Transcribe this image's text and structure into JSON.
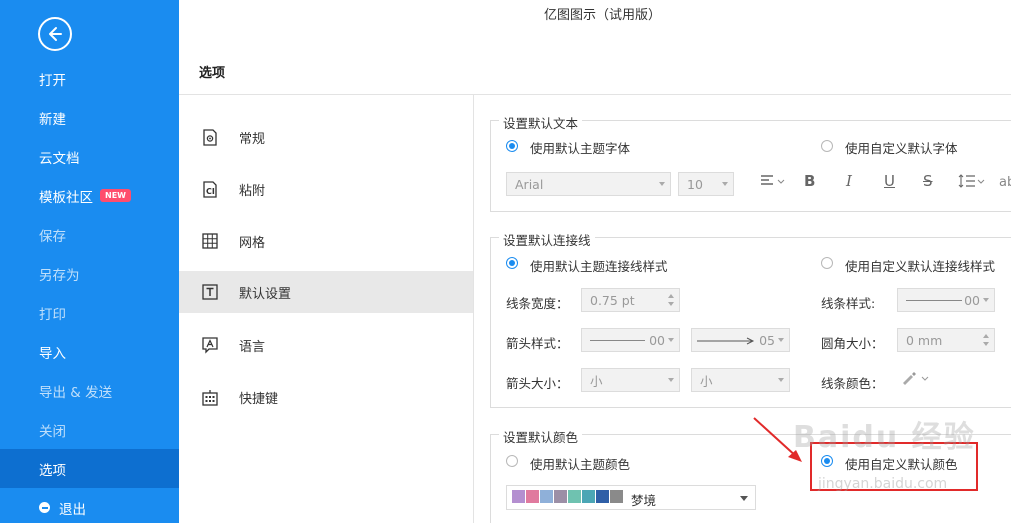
{
  "window": {
    "title": "亿图图示（试用版）"
  },
  "leftnav": {
    "items": [
      {
        "label": "打开",
        "name": "nav-open"
      },
      {
        "label": "新建",
        "name": "nav-new"
      },
      {
        "label": "云文档",
        "name": "nav-cloud-docs"
      },
      {
        "label": "模板社区",
        "name": "nav-template-community"
      },
      {
        "label": "保存",
        "name": "nav-save"
      },
      {
        "label": "另存为",
        "name": "nav-save-as"
      },
      {
        "label": "打印",
        "name": "nav-print"
      },
      {
        "label": "导入",
        "name": "nav-import"
      },
      {
        "label": "导出 & 发送",
        "name": "nav-export-send"
      },
      {
        "label": "关闭",
        "name": "nav-close"
      },
      {
        "label": "选项",
        "name": "nav-options"
      },
      {
        "label": "退出",
        "name": "nav-exit"
      }
    ],
    "badge": "NEW"
  },
  "options": {
    "title": "选项",
    "categories": [
      {
        "label": "常规",
        "icon": "gear-doc-icon"
      },
      {
        "label": "粘附",
        "icon": "snap-icon"
      },
      {
        "label": "网格",
        "icon": "grid-icon"
      },
      {
        "label": "默认设置",
        "icon": "text-box-icon"
      },
      {
        "label": "语言",
        "icon": "language-icon"
      },
      {
        "label": "快捷键",
        "icon": "keyboard-icon"
      }
    ]
  },
  "text_group": {
    "title": "设置默认文本",
    "radio_theme": "使用默认主题字体",
    "radio_custom": "使用自定义默认字体",
    "font": "Arial",
    "size": "10",
    "tail": "ab"
  },
  "connector_group": {
    "title": "设置默认连接线",
    "radio_theme": "使用默认主题连接线样式",
    "radio_custom": "使用自定义默认连接线样式",
    "line_width_label": "线条宽度：",
    "line_width": "0.75 pt",
    "line_style_label": "线条样式:",
    "line_style": "00",
    "arrow_style_label": "箭头样式：",
    "arrow_start": "00",
    "arrow_end": "05",
    "corner_label": "圆角大小：",
    "corner": "0 mm",
    "arrow_size_label": "箭头大小：",
    "arrow_size_start": "小",
    "arrow_size_end": "小",
    "line_color_label": "线条颜色："
  },
  "color_group": {
    "title": "设置默认颜色",
    "radio_theme": "使用默认主题颜色",
    "radio_custom": "使用自定义默认颜色",
    "theme_name": "梦境",
    "swatches": [
      "#b48fd0",
      "#e07a9e",
      "#8fb0d9",
      "#9c8fa6",
      "#6fc2b0",
      "#4ba6b5",
      "#2f5fa7",
      "#8a8a8a"
    ]
  },
  "watermark": {
    "text": "Baidu 经验",
    "url": "jingyan.baidu.com"
  },
  "colors": {
    "accent": "#1a8cf0",
    "highlight": "#e12a2a"
  }
}
